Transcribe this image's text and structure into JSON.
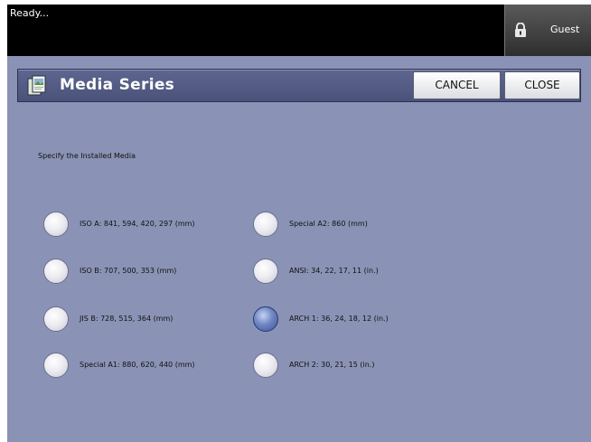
{
  "status": {
    "text": "Ready..."
  },
  "user": {
    "label": "Guest",
    "icon": "lock-icon"
  },
  "dialog": {
    "title": "Media Series",
    "icon": "media-icon",
    "cancel_label": "CANCEL",
    "close_label": "CLOSE"
  },
  "instruction": "Specify the Installed Media",
  "options": [
    {
      "label": "ISO A: 841, 594, 420, 297 (mm)",
      "selected": false
    },
    {
      "label": "ISO B: 707, 500, 353 (mm)",
      "selected": false
    },
    {
      "label": "JIS B: 728, 515, 364 (mm)",
      "selected": false
    },
    {
      "label": "Special A1: 880, 620, 440 (mm)",
      "selected": false
    },
    {
      "label": "Special A2: 860 (mm)",
      "selected": false
    },
    {
      "label": "ANSI: 34, 22, 17, 11 (in.)",
      "selected": false
    },
    {
      "label": "ARCH 1: 36, 24, 18, 12 (in.)",
      "selected": true
    },
    {
      "label": "ARCH 2: 30, 21, 15 (in.)",
      "selected": false
    }
  ],
  "colors": {
    "panel": "#8a93b5",
    "header": "#4f5680",
    "selected_radio": "#4a62a8"
  }
}
